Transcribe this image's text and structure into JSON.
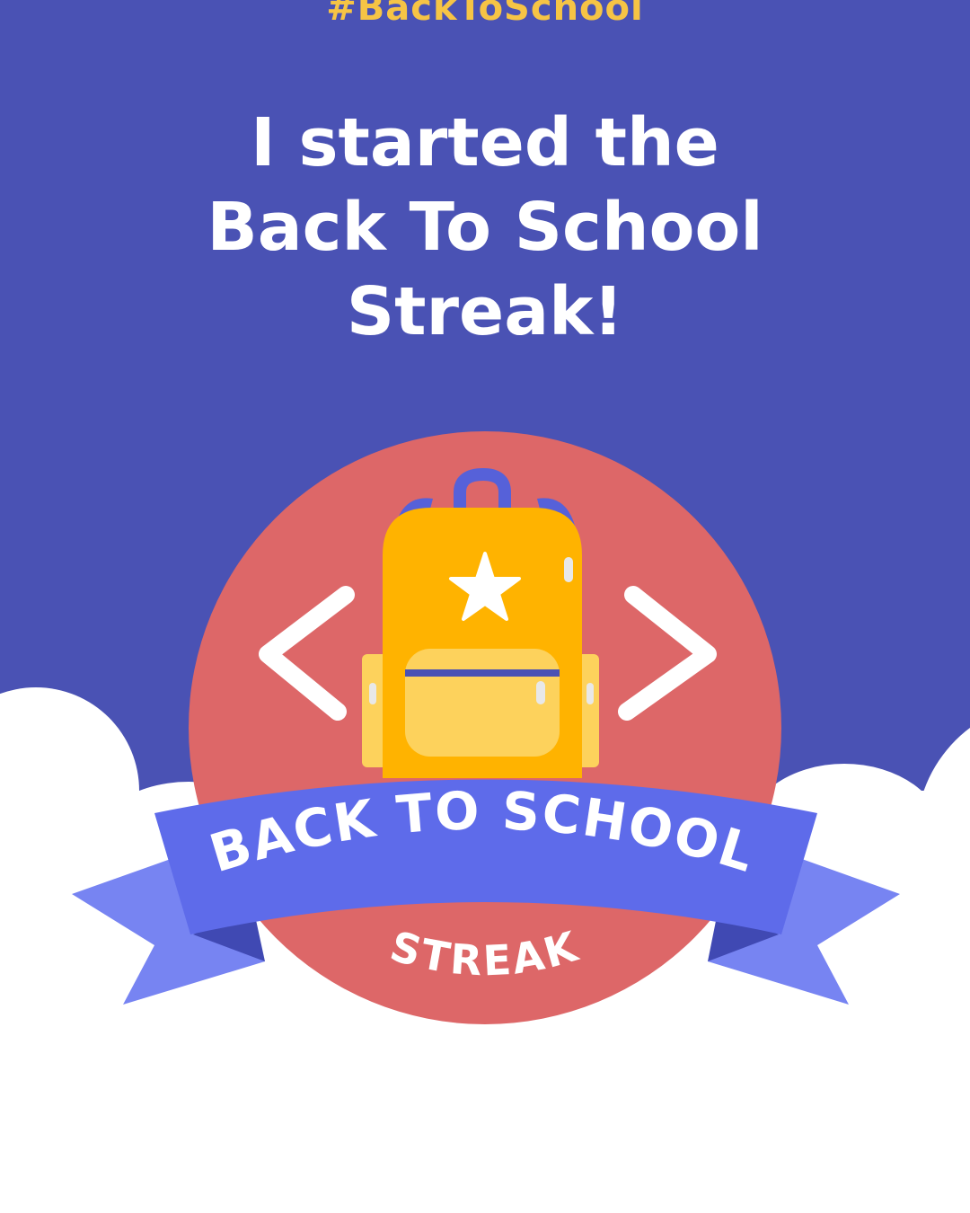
{
  "hashtag": "#BackToSchool",
  "headline": {
    "line1": "I started the",
    "line2": "Back To School",
    "line3": "Streak!"
  },
  "badge": {
    "ribbon_text": "BACK TO SCHOOL",
    "sub_text": "STREAK",
    "icons": [
      "backpack-icon",
      "star-icon",
      "chevron-left-icon",
      "chevron-right-icon"
    ]
  },
  "colors": {
    "background_top": "#4a52b4",
    "cloud": "#ffffff",
    "hashtag": "#f6c445",
    "badge_circle": "#dd6768",
    "backpack": "#ffb300",
    "backpack_pocket": "#fdd25c",
    "ribbon_front": "#5e6bea",
    "ribbon_tails": "#7784f2",
    "strap": "#5661d9"
  }
}
